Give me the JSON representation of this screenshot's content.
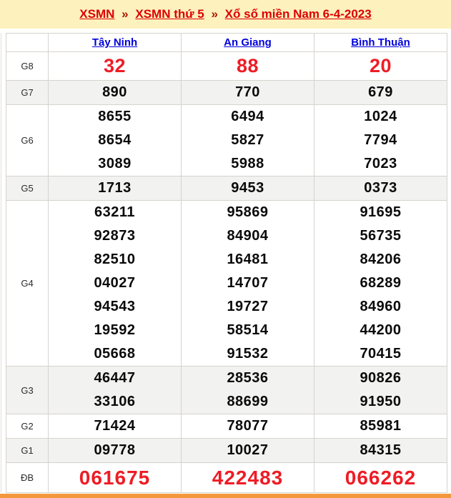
{
  "breadcrumb": {
    "separator": "»",
    "items": [
      {
        "label": "XSMN"
      },
      {
        "label": "XSMN thứ 5"
      },
      {
        "label": "Xổ số miền Nam 6-4-2023"
      }
    ]
  },
  "table": {
    "columns": [
      {
        "label": "Tây Ninh"
      },
      {
        "label": "An Giang"
      },
      {
        "label": "Bình Thuận"
      }
    ],
    "rows": [
      {
        "label": "G8",
        "highlight": true,
        "shade": false,
        "values": [
          [
            "32"
          ],
          [
            "88"
          ],
          [
            "20"
          ]
        ]
      },
      {
        "label": "G7",
        "highlight": false,
        "shade": true,
        "values": [
          [
            "890"
          ],
          [
            "770"
          ],
          [
            "679"
          ]
        ]
      },
      {
        "label": "G6",
        "highlight": false,
        "shade": false,
        "values": [
          [
            "8655",
            "8654",
            "3089"
          ],
          [
            "6494",
            "5827",
            "5988"
          ],
          [
            "1024",
            "7794",
            "7023"
          ]
        ]
      },
      {
        "label": "G5",
        "highlight": false,
        "shade": true,
        "values": [
          [
            "1713"
          ],
          [
            "9453"
          ],
          [
            "0373"
          ]
        ]
      },
      {
        "label": "G4",
        "highlight": false,
        "shade": false,
        "values": [
          [
            "63211",
            "92873",
            "82510",
            "04027",
            "94543",
            "19592",
            "05668"
          ],
          [
            "95869",
            "84904",
            "16481",
            "14707",
            "19727",
            "58514",
            "91532"
          ],
          [
            "91695",
            "56735",
            "84206",
            "68289",
            "84960",
            "44200",
            "70415"
          ]
        ]
      },
      {
        "label": "G3",
        "highlight": false,
        "shade": true,
        "values": [
          [
            "46447",
            "33106"
          ],
          [
            "28536",
            "88699"
          ],
          [
            "90826",
            "91950"
          ]
        ]
      },
      {
        "label": "G2",
        "highlight": false,
        "shade": false,
        "values": [
          [
            "71424"
          ],
          [
            "78077"
          ],
          [
            "85981"
          ]
        ]
      },
      {
        "label": "G1",
        "highlight": false,
        "shade": true,
        "values": [
          [
            "09778"
          ],
          [
            "10027"
          ],
          [
            "84315"
          ]
        ]
      },
      {
        "label": "ĐB",
        "highlight": true,
        "shade": false,
        "values": [
          [
            "061675"
          ],
          [
            "422483"
          ],
          [
            "066262"
          ]
        ]
      }
    ]
  },
  "colors": {
    "banner_bg": "#fdf1be",
    "breadcrumb_link_red": "#dd0000",
    "breadcrumb_separator_red": "#a81600",
    "column_link_blue": "#0000dd",
    "highlight_number_red": "#ee1c25",
    "shaded_row_bg": "#f2f2f0",
    "table_border": "#d6d3cc",
    "bottom_bar_orange": "#f5983b"
  }
}
